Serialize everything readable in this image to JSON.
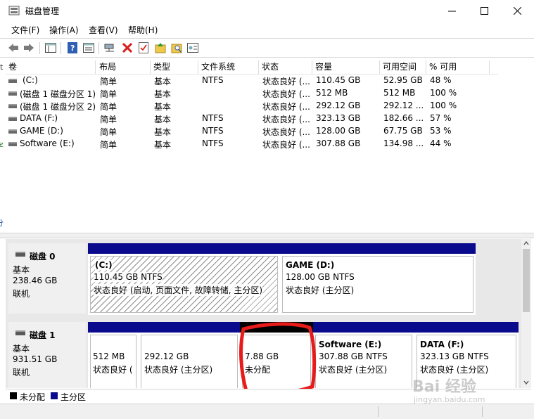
{
  "window": {
    "title": "磁盘管理",
    "minimize_glyph": "—",
    "maximize_glyph": "☐",
    "close_glyph": "✕"
  },
  "menu": {
    "file": "文件(F)",
    "action": "操作(A)",
    "view": "查看(V)",
    "help": "帮助(H)"
  },
  "toolbar": {
    "icons": [
      "back-icon",
      "forward-icon",
      "console-tree-icon",
      "help-icon",
      "properties-icon",
      "connect-icon",
      "delete-icon",
      "check-icon",
      "folder-up-icon",
      "search-folder-icon",
      "export-icon"
    ]
  },
  "volume_list": {
    "headers": [
      "卷",
      "布局",
      "类型",
      "文件系统",
      "状态",
      "容量",
      "可用空间",
      "% 可用"
    ],
    "rows": [
      {
        "name": "(C:)",
        "layout": "简单",
        "type": "基本",
        "fs": "NTFS",
        "status": "状态良好 (...",
        "capacity": "110.45 GB",
        "free": "52.95 GB",
        "pct": "48 %"
      },
      {
        "name": "(磁盘 1 磁盘分区 1)",
        "layout": "简单",
        "type": "基本",
        "fs": "",
        "status": "状态良好 (...",
        "capacity": "512 MB",
        "free": "512 MB",
        "pct": "100 %"
      },
      {
        "name": "(磁盘 1 磁盘分区 2)",
        "layout": "简单",
        "type": "基本",
        "fs": "",
        "status": "状态良好 (...",
        "capacity": "292.12 GB",
        "free": "292.12 ...",
        "pct": "100 %"
      },
      {
        "name": "DATA (F:)",
        "layout": "简单",
        "type": "基本",
        "fs": "NTFS",
        "status": "状态良好 (...",
        "capacity": "323.13 GB",
        "free": "182.66 ...",
        "pct": "57 %"
      },
      {
        "name": "GAME (D:)",
        "layout": "简单",
        "type": "基本",
        "fs": "NTFS",
        "status": "状态良好 (...",
        "capacity": "128.00 GB",
        "free": "67.75 GB",
        "pct": "53 %"
      },
      {
        "name": "Software (E:)",
        "layout": "简单",
        "type": "基本",
        "fs": "NTFS",
        "status": "状态良好 (...",
        "capacity": "307.88 GB",
        "free": "134.98 ...",
        "pct": "44 %"
      }
    ]
  },
  "disks": [
    {
      "name": "磁盘 0",
      "type": "基本",
      "size": "238.46 GB",
      "state": "联机",
      "partitions": [
        {
          "label": "(C:)",
          "size": "110.45 GB NTFS",
          "status": "状态良好 (启动, 页面文件, 故障转储, 主分区)"
        },
        {
          "label": "GAME  (D:)",
          "size": "128.00 GB NTFS",
          "status": "状态良好 (主分区)"
        }
      ]
    },
    {
      "name": "磁盘 1",
      "type": "基本",
      "size": "931.51 GB",
      "state": "联机",
      "partitions": [
        {
          "label": "",
          "size": "512 MB",
          "status": "状态良好 ("
        },
        {
          "label": "",
          "size": "292.12 GB",
          "status": "状态良好 (主分区)"
        },
        {
          "label": "",
          "size": "7.88 GB",
          "status": "未分配"
        },
        {
          "label": "Software  (E:)",
          "size": "307.88 GB NTFS",
          "status": "状态良好 (主分区)"
        },
        {
          "label": "DATA  (F:)",
          "size": "323.13 GB NTFS",
          "status": "状态良好 (主分区)"
        }
      ]
    }
  ],
  "legend": {
    "unallocated": "未分配",
    "primary": "主分区",
    "unallocated_color": "#000000",
    "primary_color": "#0a0a8c"
  },
  "left_edge_glyphs": [
    "t",
    "字",
    "分"
  ],
  "watermark": {
    "text": "Bai  经验",
    "url": "jingyan.baidu.com"
  }
}
